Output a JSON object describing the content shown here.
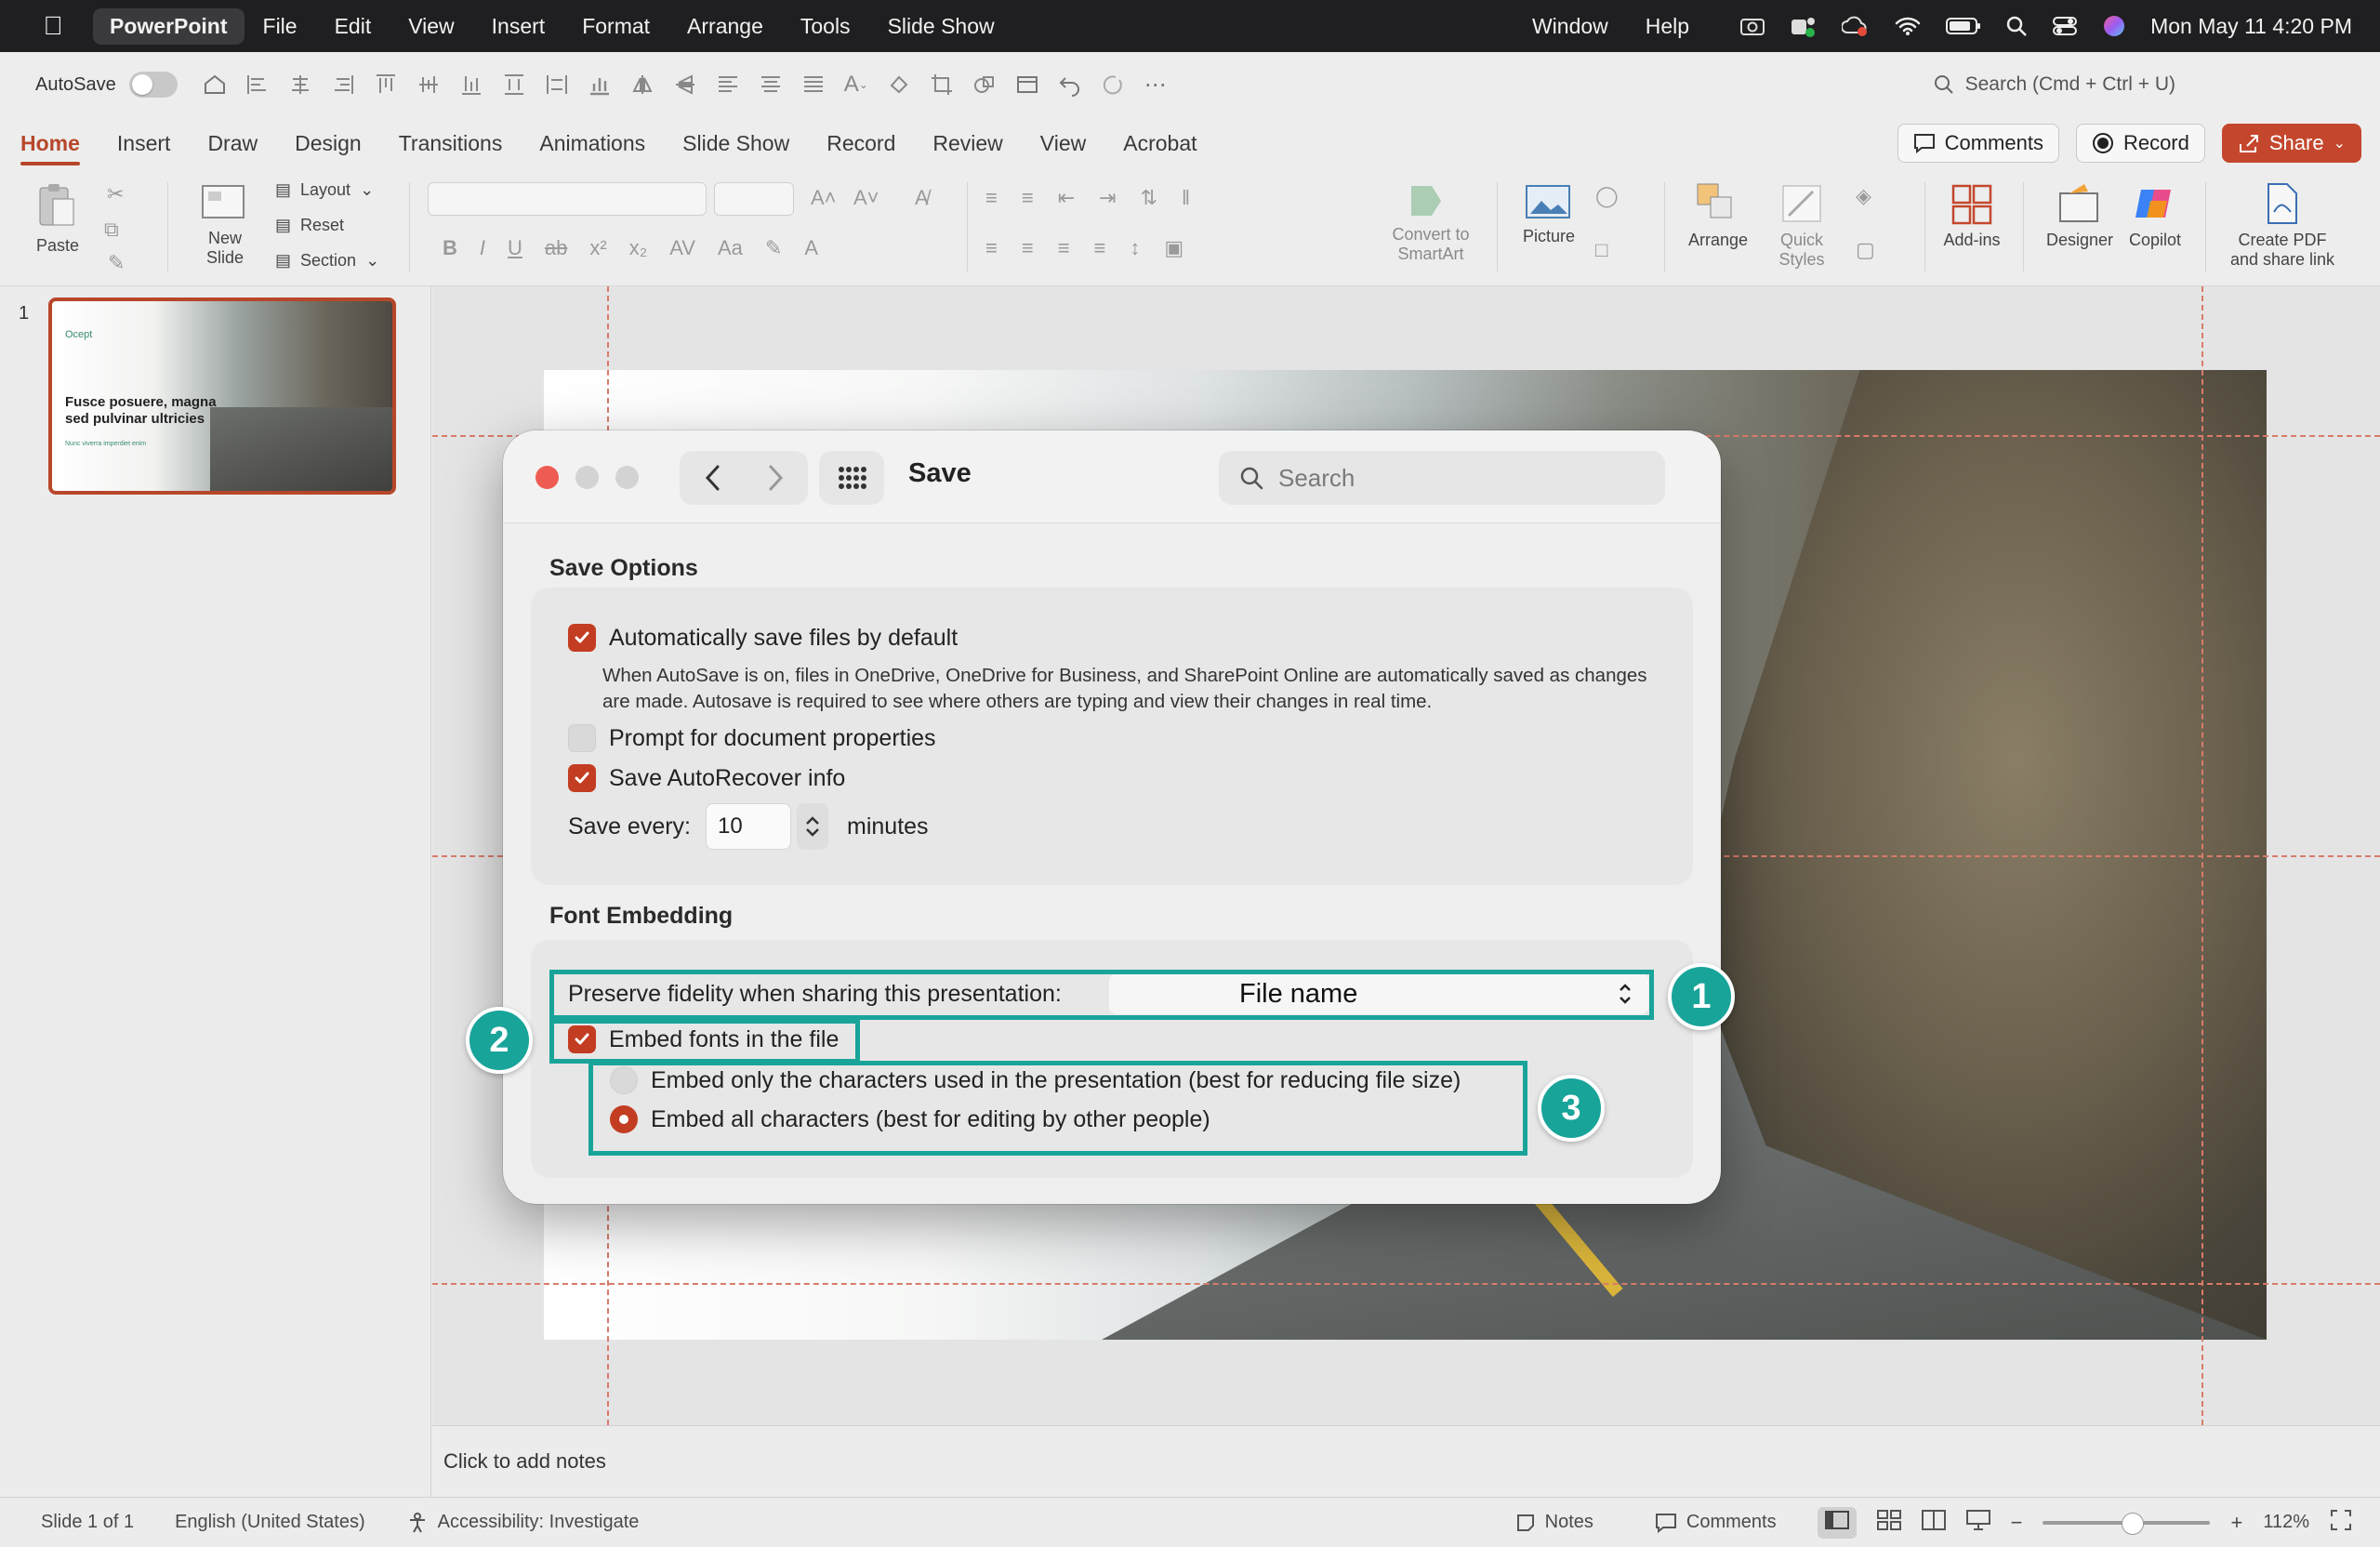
{
  "menubar": {
    "app_name": "PowerPoint",
    "items": [
      "File",
      "Edit",
      "View",
      "Insert",
      "Format",
      "Arrange",
      "Tools",
      "Slide Show"
    ],
    "right_items": [
      "Window",
      "Help"
    ],
    "clock": "Mon May 11  4:20 PM",
    "status_icons": [
      "camera-icon",
      "teams-icon",
      "creative-cloud-icon",
      "wifi-icon",
      "battery-icon",
      "spotlight-icon",
      "control-center-icon",
      "siri-icon"
    ]
  },
  "qat": {
    "autosave_label": "AutoSave",
    "search_placeholder": "Search (Cmd + Ctrl + U)"
  },
  "ribbon_tabs": [
    "Home",
    "Insert",
    "Draw",
    "Design",
    "Transitions",
    "Animations",
    "Slide Show",
    "Record",
    "Review",
    "View",
    "Acrobat"
  ],
  "active_tab": "Home",
  "ribbon_right": {
    "comments": "Comments",
    "record": "Record",
    "share": "Share"
  },
  "ribbon": {
    "paste": "Paste",
    "new_slide": "New\nSlide",
    "layout": "Layout",
    "reset": "Reset",
    "section": "Section",
    "convert_smartart": "Convert to\nSmartArt",
    "picture": "Picture",
    "arrange": "Arrange",
    "quick_styles": "Quick\nStyles",
    "addins": "Add-ins",
    "designer": "Designer",
    "copilot": "Copilot",
    "create_pdf": "Create PDF\nand share link"
  },
  "thumbnail": {
    "number": "1",
    "logo": "Ocept",
    "title": "Fusce posuere, magna sed pulvinar ultricies",
    "subtitle": "Nunc viverra imperdiet enim"
  },
  "notes_placeholder": "Click to add notes",
  "status": {
    "slide": "Slide 1 of 1",
    "language": "English (United States)",
    "accessibility": "Accessibility: Investigate",
    "notes": "Notes",
    "comments": "Comments",
    "zoom": "112%"
  },
  "dialog": {
    "title": "Save",
    "search_placeholder": "Search",
    "save_options_heading": "Save Options",
    "autosave_label": "Automatically save files by default",
    "autosave_help": "When AutoSave is on, files in OneDrive, OneDrive for Business, and SharePoint Online are automatically saved as changes are made. Autosave is required to see where others are typing and view their changes in real time.",
    "prompt_label": "Prompt for document properties",
    "autorecover_label": "Save AutoRecover info",
    "save_every_label": "Save every:",
    "save_every_value": "10",
    "minutes_label": "minutes",
    "font_embedding_heading": "Font Embedding",
    "preserve_label": "Preserve fidelity when sharing this presentation:",
    "preserve_value": "File name",
    "embed_fonts_label": "Embed fonts in the file",
    "embed_only_label": "Embed only the characters used in the presentation (best for reducing file size)",
    "embed_all_label": "Embed all characters (best for editing by other people)",
    "checked": {
      "autosave": true,
      "prompt": false,
      "autorecover": true,
      "embed_fonts": true
    },
    "selected_embed_option": "embed_all"
  },
  "annotations": {
    "badge1": "1",
    "badge2": "2",
    "badge3": "3"
  },
  "colors": {
    "accent": "#c33d22",
    "highlight": "#19a49a",
    "tab_active": "#b7472a"
  }
}
